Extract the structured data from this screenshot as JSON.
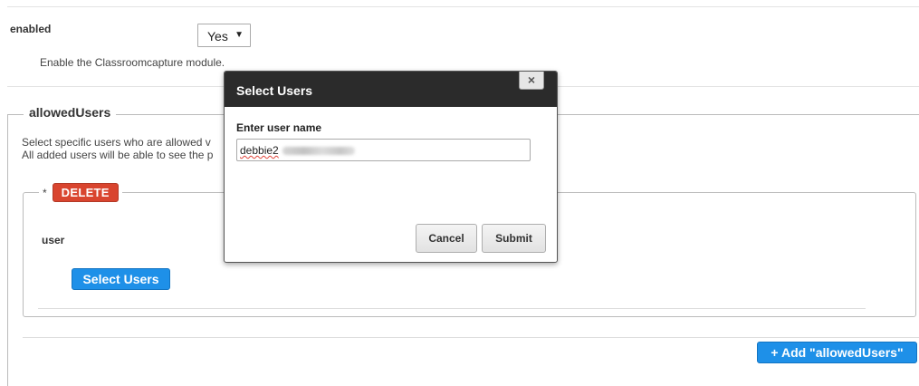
{
  "settings": {
    "enabled": {
      "label": "enabled",
      "value": "Yes",
      "description": "Enable the Classroomcapture module."
    }
  },
  "allowed_users": {
    "legend": "allowedUsers",
    "description_line1": "Select specific users who are allowed v",
    "description_line2": "All added users will be able to see the p",
    "entry": {
      "required_mark": "*",
      "delete_label": "DELETE",
      "user_label": "user",
      "select_users_label": "Select Users"
    },
    "add_label": "+ Add \"allowedUsers\""
  },
  "modal": {
    "title": "Select Users",
    "close_symbol": "×",
    "field_label": "Enter user name",
    "input_value": "debbie2",
    "cancel_label": "Cancel",
    "submit_label": "Submit"
  },
  "colors": {
    "primary_button": "#1e90e8",
    "danger_button": "#d9452f",
    "modal_header": "#2b2b2b"
  },
  "icons": {
    "close": "close-icon",
    "dropdown": "chevron-down-icon"
  }
}
